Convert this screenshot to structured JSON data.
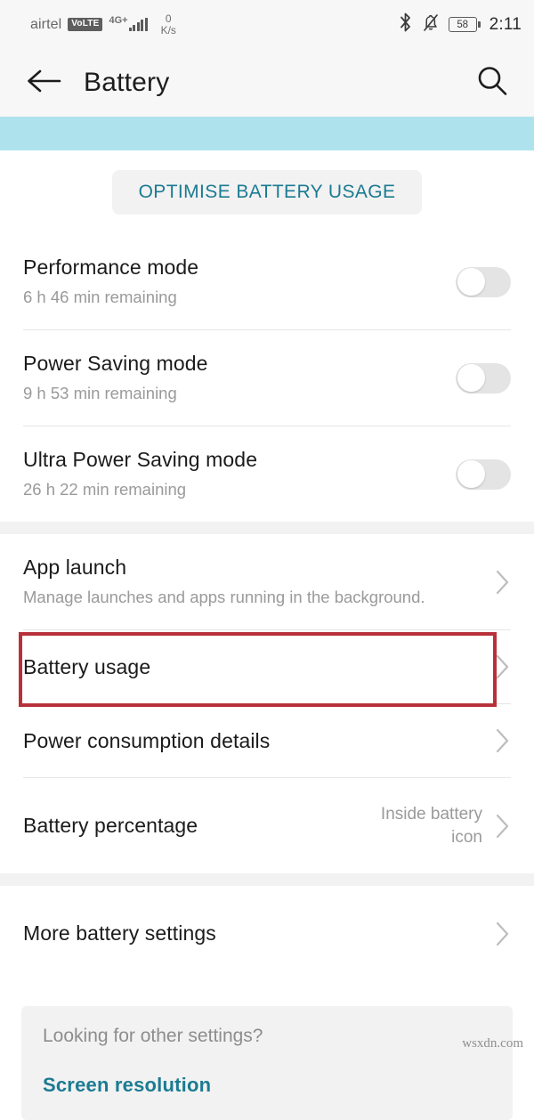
{
  "statusbar": {
    "carrier": "airtel",
    "volte_badge": "VoLTE",
    "network_type": "4G+",
    "data_speed_value": "0",
    "data_speed_unit": "K/s",
    "bluetooth_icon": "bluetooth-icon",
    "silent_icon": "bell-muted-icon",
    "battery_level": "58",
    "clock": "2:11"
  },
  "appbar": {
    "back_icon": "back-arrow-icon",
    "title": "Battery",
    "search_icon": "search-icon"
  },
  "optimise": {
    "label": "OPTIMISE BATTERY USAGE"
  },
  "modes": [
    {
      "title": "Performance mode",
      "subtitle": "6 h 46 min remaining",
      "toggle_state": "off"
    },
    {
      "title": "Power Saving mode",
      "subtitle": "9 h 53 min remaining",
      "toggle_state": "off"
    },
    {
      "title": "Ultra Power Saving mode",
      "subtitle": "26 h 22 min remaining",
      "toggle_state": "off"
    }
  ],
  "settings": [
    {
      "title": "App launch",
      "subtitle": "Manage launches and apps running in the background.",
      "value": ""
    },
    {
      "title": "Battery usage",
      "subtitle": "",
      "value": ""
    },
    {
      "title": "Power consumption details",
      "subtitle": "",
      "value": ""
    },
    {
      "title": "Battery percentage",
      "subtitle": "",
      "value": "Inside battery icon"
    }
  ],
  "more": {
    "title": "More battery settings"
  },
  "footer": {
    "question": "Looking for other settings?",
    "link": "Screen resolution"
  },
  "watermark": "wsxdn.com",
  "colors": {
    "accent_band": "#aee3ee",
    "teal_text": "#1b7b92",
    "highlight_red": "#b8303a",
    "band_gray": "#f2f2f2"
  }
}
